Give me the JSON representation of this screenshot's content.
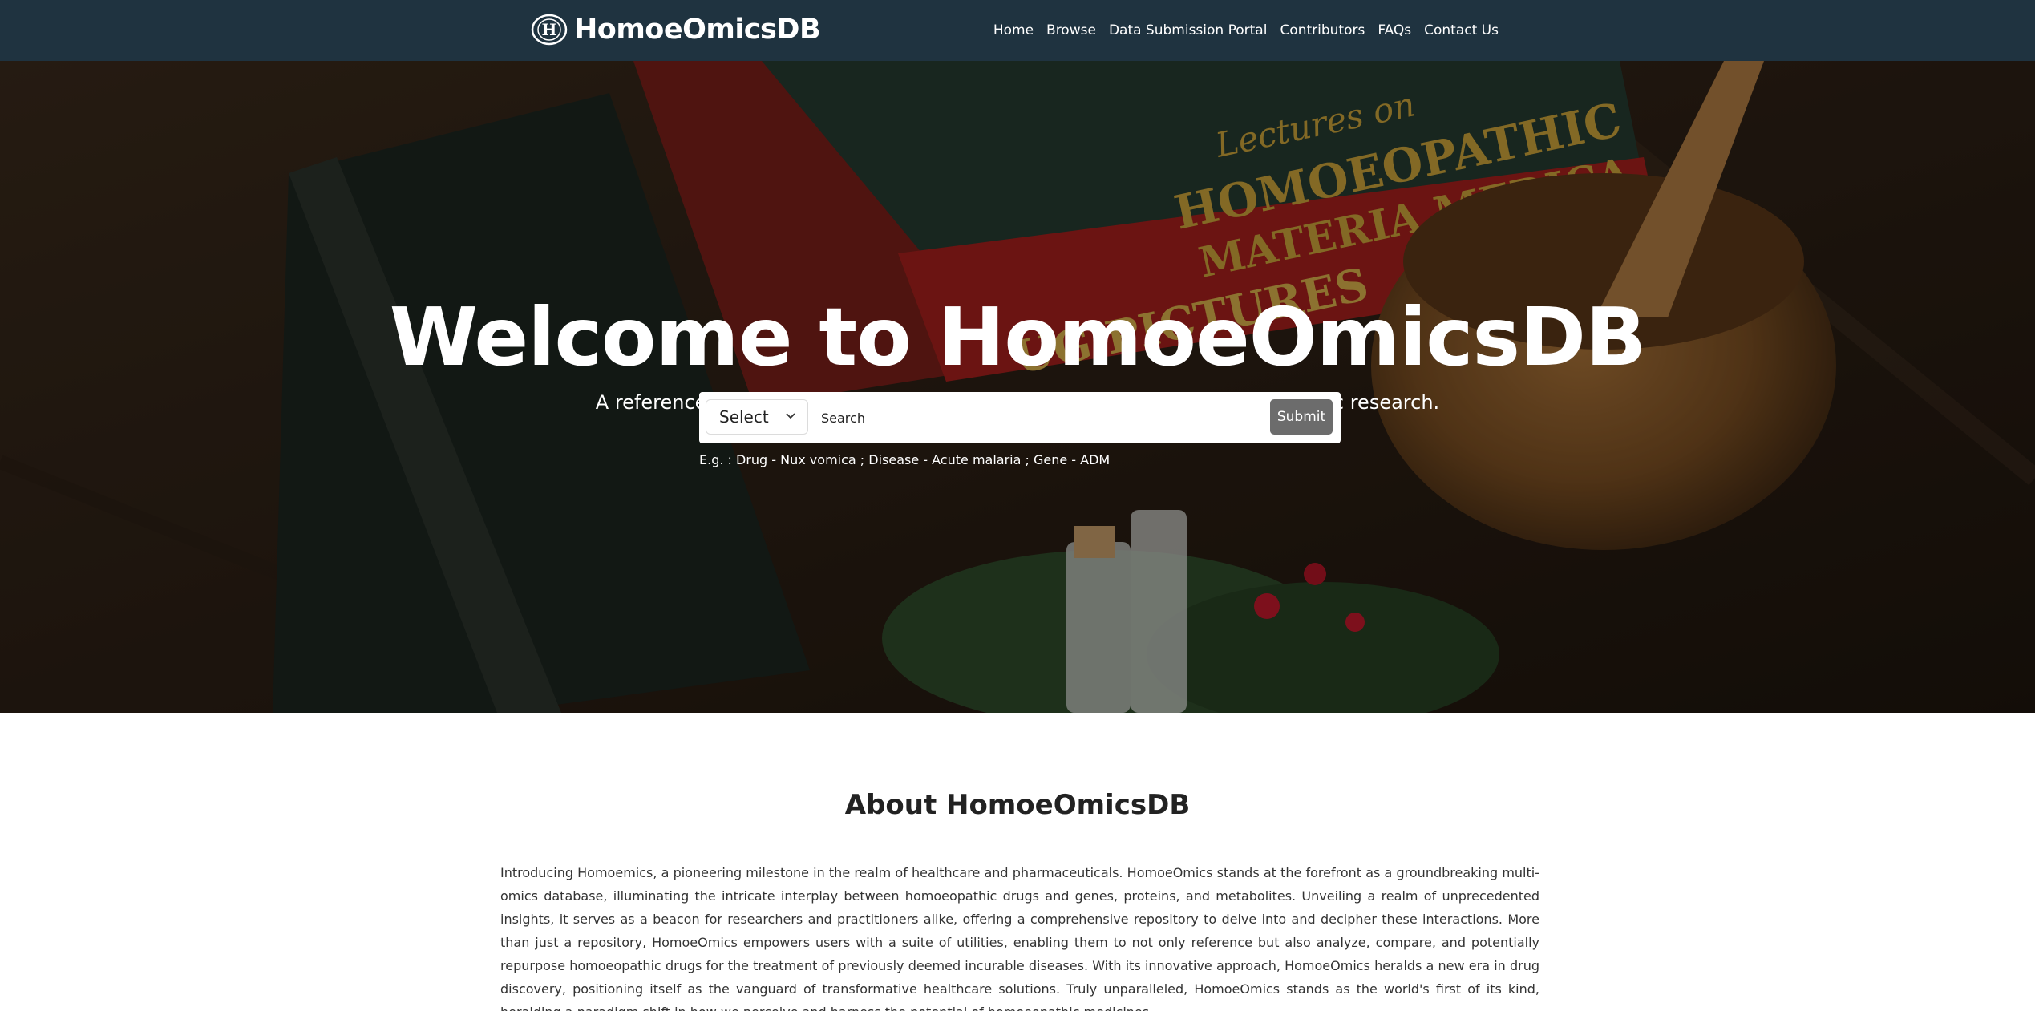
{
  "brand": {
    "name": "HomoeOmicsDB",
    "logo_icon": "homoeomics-logo-icon"
  },
  "nav": {
    "items": [
      "Home",
      "Browse",
      "Data Submission Portal",
      "Contributors",
      "FAQs",
      "Contact Us"
    ]
  },
  "hero": {
    "title": "Welcome to HomoeOmicsDB",
    "subtitle": "A reference, analysis and discovery platform for molecular level homeopathic research.",
    "search": {
      "select_value": "Select",
      "placeholder": "Search",
      "submit_label": "Submit"
    },
    "example": "E.g. : Drug - Nux vomica ; Disease - Acute malaria ; Gene - ADM"
  },
  "about": {
    "title": "About HomoeOmicsDB",
    "text": "Introducing Homoemics, a pioneering milestone in the realm of healthcare and pharmaceuticals. HomoeOmics stands at the forefront as a groundbreaking multi-omics database, illuminating the intricate interplay between homoeopathic drugs and genes, proteins, and metabolites. Unveiling a realm of unprecedented insights, it serves as a beacon for researchers and practitioners alike, offering a comprehensive repository to delve into and decipher these interactions. More than just a repository, HomoeOmics empowers users with a suite of utilities, enabling them to not only reference but also analyze, compare, and potentially repurpose homoeopathic drugs for the treatment of previously deemed incurable diseases. With its innovative approach, HomoeOmics heralds a new era in drug discovery, positioning itself as the vanguard of transformative healthcare solutions. Truly unparalleled, HomoeOmics stands as the world's first of its kind, heralding a paradigm shift in how we perceive and harness the potential of homoeopathic medicines."
  },
  "colors": {
    "navbar": "#1f3340",
    "submit": "#6c6c6c",
    "text": "#222222"
  }
}
